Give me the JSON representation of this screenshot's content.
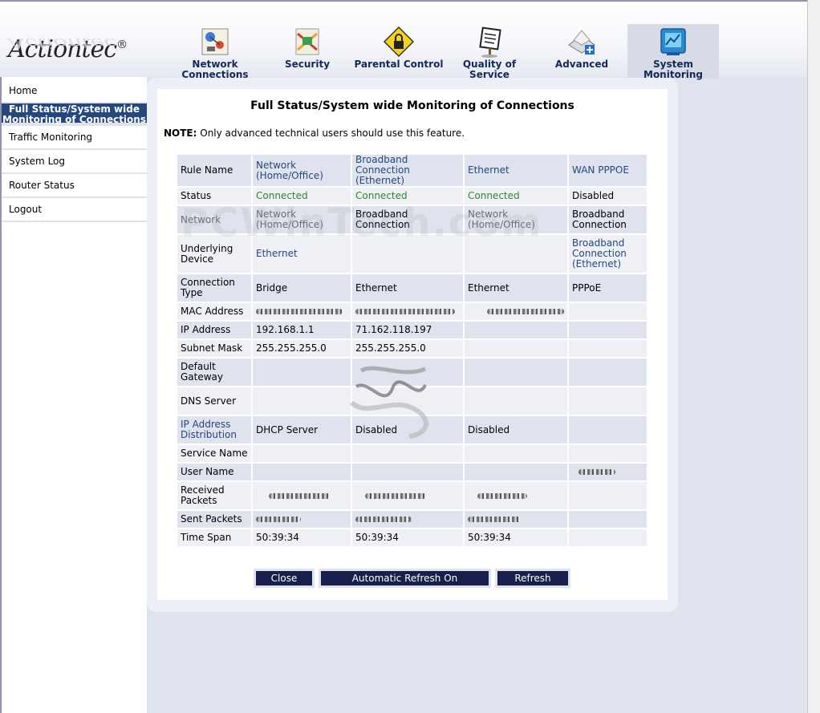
{
  "brand": {
    "name": "Actiontec",
    "reg": "®"
  },
  "nav": [
    {
      "label_line1": "Network",
      "label_line2": "Connections",
      "icon": "network-icon"
    },
    {
      "label_line1": "Security",
      "label_line2": "",
      "icon": "security-icon"
    },
    {
      "label_line1": "Parental Control",
      "label_line2": "",
      "icon": "lock-icon"
    },
    {
      "label_line1": "Quality of",
      "label_line2": "Service",
      "icon": "qos-sign-icon"
    },
    {
      "label_line1": "Advanced",
      "label_line2": "",
      "icon": "advanced-icon"
    },
    {
      "label_line1": "System",
      "label_line2": "Monitoring",
      "icon": "monitor-icon"
    }
  ],
  "sidebar": {
    "items": [
      {
        "label": "Home"
      },
      {
        "label_line1": "Full Status/System wide",
        "label_line2": "Monitoring of Connections"
      },
      {
        "label": "Traffic Monitoring"
      },
      {
        "label": "System Log"
      },
      {
        "label": "Router Status"
      },
      {
        "label": "Logout"
      }
    ]
  },
  "page": {
    "title": "Full Status/System wide Monitoring of Connections",
    "note_label": "NOTE:",
    "note_text": " Only advanced technical users should use this feature.",
    "watermark": "PCWinTech.com"
  },
  "table": {
    "rule_name": {
      "label": "Rule Name",
      "c1": "Network (Home/Office)",
      "c2": "Broadband Connection (Ethernet)",
      "c3": "Ethernet",
      "c4": "WAN PPPOE"
    },
    "status": {
      "label": "Status",
      "c1": "Connected",
      "c2": "Connected",
      "c3": "Connected",
      "c4": "Disabled"
    },
    "network": {
      "label": "Network",
      "c1": "Network (Home/Office)",
      "c2": "Broadband Connection",
      "c3": "Network (Home/Office)",
      "c4": "Broadband Connection"
    },
    "underlying": {
      "label": "Underlying Device",
      "c1": "Ethernet",
      "c2": "",
      "c3": "",
      "c4": "Broadband Connection (Ethernet)"
    },
    "conn_type": {
      "label": "Connection Type",
      "c1": "Bridge",
      "c2": "Ethernet",
      "c3": "Ethernet",
      "c4": "PPPoE"
    },
    "mac": {
      "label": "MAC Address"
    },
    "ip": {
      "label": "IP Address",
      "c1": "192.168.1.1",
      "c2": "71.162.118.197",
      "c3": "",
      "c4": ""
    },
    "subnet": {
      "label": "Subnet Mask",
      "c1": "255.255.255.0",
      "c2": "255.255.255.0",
      "c3": "",
      "c4": ""
    },
    "gateway": {
      "label": "Default Gateway"
    },
    "dns": {
      "label": "DNS Server"
    },
    "ip_dist": {
      "label": "IP Address Distribution",
      "c1": "DHCP Server",
      "c2": "Disabled",
      "c3": "Disabled",
      "c4": ""
    },
    "service": {
      "label": "Service Name"
    },
    "user": {
      "label": "User Name"
    },
    "rx": {
      "label": "Received Packets"
    },
    "tx": {
      "label": "Sent Packets"
    },
    "time": {
      "label": "Time Span",
      "c1": "50:39:34",
      "c2": "50:39:34",
      "c3": "50:39:34",
      "c4": ""
    }
  },
  "buttons": {
    "close": "Close",
    "auto_refresh": "Automatic Refresh On",
    "refresh": "Refresh"
  }
}
